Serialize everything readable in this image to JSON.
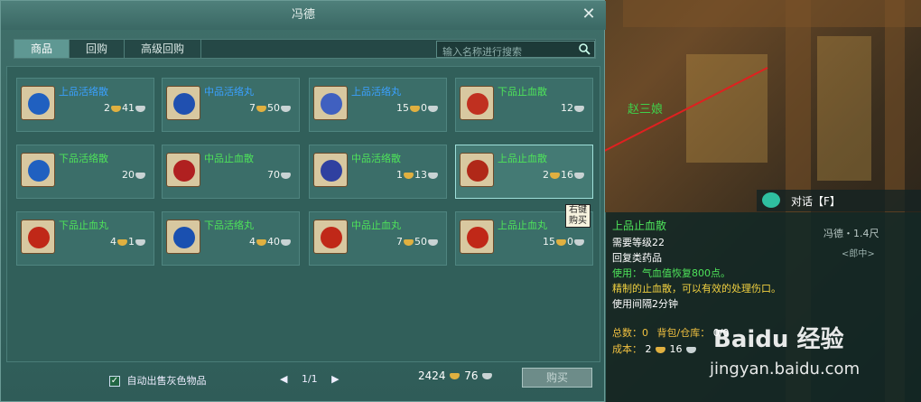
{
  "scene": {
    "npc_label": "赵三娘"
  },
  "window": {
    "title": "冯德",
    "close_icon": "close-icon"
  },
  "tabs": [
    {
      "label": "商品",
      "active": true
    },
    {
      "label": "回购",
      "active": false
    },
    {
      "label": "高级回购",
      "active": false
    }
  ],
  "search": {
    "placeholder": "输入名称进行搜索"
  },
  "items": [
    {
      "name": "上品活络散",
      "tier": "blue",
      "price": [
        "2",
        "41"
      ],
      "icon_color": "#2060c0"
    },
    {
      "name": "中品活络丸",
      "tier": "blue",
      "price": [
        "7",
        "50"
      ],
      "icon_color": "#2050b0"
    },
    {
      "name": "上品活络丸",
      "tier": "blue",
      "price": [
        "15",
        "0"
      ],
      "icon_color": "#4060c0"
    },
    {
      "name": "下品止血散",
      "tier": "green",
      "price": [
        "12"
      ],
      "icon_color": "#c03020"
    },
    {
      "name": "下品活络散",
      "tier": "green",
      "price": [
        "20"
      ],
      "icon_color": "#2060c0"
    },
    {
      "name": "中品止血散",
      "tier": "green",
      "price": [
        "70"
      ],
      "icon_color": "#b02020"
    },
    {
      "name": "中品活络散",
      "tier": "green",
      "price": [
        "1",
        "13"
      ],
      "icon_color": "#3040a0"
    },
    {
      "name": "上品止血散",
      "tier": "green",
      "price": [
        "2",
        "16"
      ],
      "icon_color": "#b02818"
    },
    {
      "name": "下品止血丸",
      "tier": "green",
      "price": [
        "4",
        "1"
      ],
      "icon_color": "#c02818"
    },
    {
      "name": "下品活络丸",
      "tier": "green",
      "price": [
        "4",
        "40"
      ],
      "icon_color": "#1a50b0"
    },
    {
      "name": "中品止血丸",
      "tier": "green",
      "price": [
        "7",
        "50"
      ],
      "icon_color": "#c02818"
    },
    {
      "name": "上品止血丸",
      "tier": "green",
      "price": [
        "15",
        "0"
      ],
      "icon_color": "#c02818"
    }
  ],
  "right_click_tip": "右键购买",
  "footer": {
    "auto_sell_label": "自动出售灰色物品",
    "page": "1/1",
    "gold": "2424",
    "silver": "76",
    "buy_label": "购买"
  },
  "talk": {
    "label": "对话【F】"
  },
  "npc_right": {
    "name": "冯德・1.4尺",
    "title": "<郎中>"
  },
  "tooltip": {
    "title": "上品止血散",
    "level": "需要等级22",
    "type": "回复类药品",
    "use": "使用：气血值恢复800点。",
    "desc": "精制的止血散，可以有效的处理伤口。",
    "interval": "使用间隔2分钟",
    "total_label": "总数：0",
    "bag_label": "背包/仓库：",
    "bag_value": "0/0",
    "cost_label": "成本：",
    "cost_gold": "2",
    "cost_silver": "16"
  },
  "watermark": {
    "logo": "Baidu 经验",
    "url": "jingyan.baidu.com"
  },
  "colors": {
    "blue_tier": "#3aa0ff",
    "green_tier": "#4ee35a",
    "gold": "#e0b040",
    "silver": "#c9d3d4"
  }
}
